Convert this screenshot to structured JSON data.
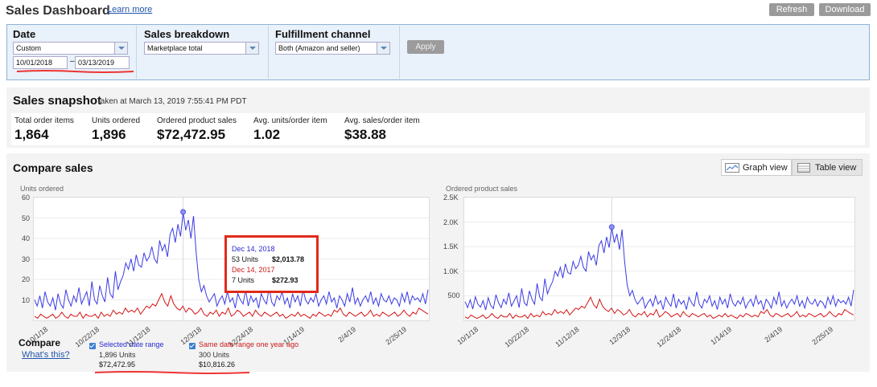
{
  "header": {
    "title": "Sales Dashboard",
    "learn_more": "Learn more",
    "refresh_label": "Refresh",
    "download_label": "Download"
  },
  "filters": {
    "date": {
      "label": "Date",
      "value": "Custom",
      "start": "10/01/2018",
      "end": "03/13/2019",
      "dash": "–"
    },
    "breakdown": {
      "label": "Sales breakdown",
      "value": "Marketplace total"
    },
    "fulfillment": {
      "label": "Fulfillment channel",
      "value": "Both (Amazon and seller)"
    },
    "apply_label": "Apply"
  },
  "snapshot": {
    "title": "Sales snapshot",
    "subtitle": "taken at March 13, 2019 7:55:41 PM PDT",
    "metrics": [
      {
        "label": "Total order items",
        "value": "1,864"
      },
      {
        "label": "Units ordered",
        "value": "1,896"
      },
      {
        "label": "Ordered product sales",
        "value": "$72,472.95"
      },
      {
        "label": "Avg. units/order item",
        "value": "1.02"
      },
      {
        "label": "Avg. sales/order item",
        "value": "$38.88"
      }
    ]
  },
  "compare": {
    "title": "Compare sales",
    "graph_view": "Graph view",
    "table_view": "Table view",
    "compare_label": "Compare",
    "whats_this": "What's this?",
    "selected": {
      "label": "Selected date range",
      "units": "1,896 Units",
      "sales": "$72,472.95"
    },
    "previous": {
      "label": "Same date range one year ago",
      "units": "300 Units",
      "sales": "$10,816.26"
    }
  },
  "tooltip": {
    "date1": "Dec 14, 2018",
    "units1": "53 Units",
    "sales1": "$2,013.78",
    "date2": "Dec 14, 2017",
    "units2": "7 Units",
    "sales2": "$272.93"
  },
  "colors": {
    "current": "#3a3ae6",
    "previous": "#d41616",
    "accent": "#2255aa"
  },
  "chart_data": [
    {
      "type": "line",
      "ylabel": "Units ordered",
      "ylim": [
        0,
        60
      ],
      "y_ticks": [
        "60",
        "50",
        "40",
        "30",
        "20",
        "10"
      ],
      "x_ticks": [
        "10/1/18",
        "10/22/18",
        "11/12/18",
        "12/3/18",
        "12/24/18",
        "1/14/19",
        "2/4/19",
        "2/25/19"
      ],
      "series": [
        {
          "values": [
            10,
            7,
            12,
            6,
            14,
            9,
            7,
            11,
            5,
            13,
            8,
            6,
            15,
            10,
            7,
            12,
            9,
            16,
            8,
            11,
            14,
            7,
            19,
            10,
            8,
            17,
            12,
            9,
            21,
            13,
            11,
            24,
            15,
            19,
            22,
            28,
            25,
            30,
            24,
            32,
            27,
            26,
            33,
            29,
            31,
            36,
            30,
            28,
            39,
            34,
            37,
            31,
            42,
            45,
            38,
            47,
            41,
            53,
            44,
            49,
            40,
            51,
            33,
            20,
            14,
            17,
            12,
            9,
            11,
            13,
            7,
            10,
            12,
            8,
            14,
            9,
            11,
            6,
            13,
            10,
            8,
            15,
            7,
            12,
            9,
            11,
            6,
            13,
            10,
            8,
            16,
            9,
            7,
            12,
            10,
            14,
            8,
            11,
            6,
            13,
            9,
            12,
            7,
            15,
            10,
            8,
            11,
            9,
            13,
            7,
            10,
            12,
            8,
            14,
            9,
            11,
            6,
            12,
            10,
            7,
            13,
            9,
            16,
            8,
            11,
            7,
            10,
            12,
            9,
            14,
            8,
            11,
            7,
            13,
            10,
            9,
            12,
            8,
            11,
            10,
            7,
            13,
            9,
            14,
            8,
            12,
            10,
            11,
            9,
            13,
            8,
            15
          ]
        },
        {
          "values": [
            2,
            1,
            3,
            2,
            1,
            2,
            3,
            1,
            2,
            4,
            2,
            1,
            3,
            2,
            2,
            4,
            1,
            3,
            2,
            2,
            3,
            1,
            4,
            2,
            3,
            2,
            5,
            3,
            4,
            3,
            6,
            4,
            5,
            4,
            6,
            3,
            5,
            7,
            6,
            8,
            7,
            10,
            13,
            9,
            7,
            12,
            8,
            6,
            5,
            7,
            4,
            6,
            5,
            3,
            4,
            6,
            3,
            2,
            4,
            3,
            5,
            2,
            4,
            3,
            6,
            2,
            3,
            5,
            4,
            2,
            3,
            4,
            2,
            5,
            3,
            2,
            4,
            3,
            2,
            3,
            4,
            2,
            3,
            1,
            2,
            3,
            2,
            4,
            2,
            3,
            2,
            1,
            3,
            2,
            4,
            3,
            2,
            3,
            2,
            5,
            4,
            6,
            3,
            2,
            4,
            3,
            2,
            3,
            4,
            2,
            3,
            5,
            2,
            3,
            2,
            4,
            3,
            2,
            3,
            4,
            2,
            3,
            5,
            3,
            2,
            4,
            3,
            6,
            5,
            4,
            3
          ]
        }
      ]
    },
    {
      "type": "line",
      "ylabel": "Ordered product sales",
      "ylim": [
        0,
        2500
      ],
      "y_ticks": [
        "2.5K",
        "2.0K",
        "1.5K",
        "1.0K",
        "500"
      ],
      "x_ticks": [
        "10/1/18",
        "10/22/18",
        "11/12/18",
        "12/3/18",
        "12/24/18",
        "1/14/19",
        "2/4/19",
        "2/25/19"
      ],
      "series": [
        {
          "values": [
            380,
            260,
            420,
            230,
            480,
            330,
            270,
            400,
            210,
            460,
            300,
            240,
            520,
            360,
            260,
            430,
            330,
            560,
            290,
            390,
            500,
            260,
            650,
            360,
            300,
            600,
            430,
            330,
            750,
            470,
            400,
            850,
            540,
            680,
            790,
            1000,
            900,
            1080,
            860,
            1150,
            970,
            940,
            1200,
            1050,
            1120,
            1300,
            1080,
            1000,
            1400,
            1230,
            1330,
            1120,
            1520,
            1620,
            1370,
            1700,
            1480,
            1900,
            1580,
            1760,
            1440,
            1850,
            1200,
            720,
            500,
            610,
            430,
            330,
            400,
            470,
            250,
            360,
            430,
            290,
            500,
            330,
            400,
            220,
            470,
            360,
            290,
            540,
            250,
            430,
            330,
            400,
            220,
            470,
            360,
            290,
            580,
            330,
            250,
            430,
            360,
            500,
            290,
            400,
            220,
            470,
            330,
            430,
            250,
            540,
            360,
            290,
            400,
            330,
            470,
            250,
            360,
            430,
            290,
            500,
            330,
            400,
            220,
            430,
            360,
            250,
            470,
            330,
            580,
            290,
            400,
            250,
            360,
            430,
            330,
            500,
            290,
            400,
            250,
            470,
            360,
            330,
            430,
            290,
            400,
            360,
            250,
            470,
            330,
            500,
            290,
            430,
            360,
            400,
            330,
            470,
            290,
            620
          ]
        },
        {
          "values": [
            70,
            40,
            110,
            70,
            40,
            70,
            110,
            40,
            70,
            140,
            70,
            40,
            110,
            70,
            70,
            140,
            40,
            110,
            70,
            70,
            110,
            40,
            140,
            70,
            110,
            70,
            180,
            110,
            140,
            110,
            220,
            140,
            180,
            140,
            220,
            110,
            180,
            250,
            220,
            290,
            250,
            360,
            470,
            320,
            250,
            430,
            290,
            220,
            180,
            250,
            140,
            220,
            180,
            110,
            140,
            220,
            110,
            70,
            140,
            110,
            180,
            70,
            140,
            110,
            220,
            70,
            110,
            180,
            140,
            70,
            110,
            140,
            70,
            180,
            110,
            70,
            140,
            110,
            70,
            110,
            140,
            70,
            110,
            40,
            70,
            110,
            70,
            140,
            70,
            110,
            70,
            40,
            110,
            70,
            140,
            110,
            70,
            110,
            70,
            180,
            140,
            220,
            110,
            70,
            140,
            110,
            70,
            110,
            140,
            70,
            110,
            180,
            70,
            110,
            70,
            140,
            110,
            70,
            110,
            140,
            70,
            110,
            180,
            110,
            70,
            140,
            110,
            220,
            180,
            140,
            110
          ]
        }
      ]
    }
  ]
}
